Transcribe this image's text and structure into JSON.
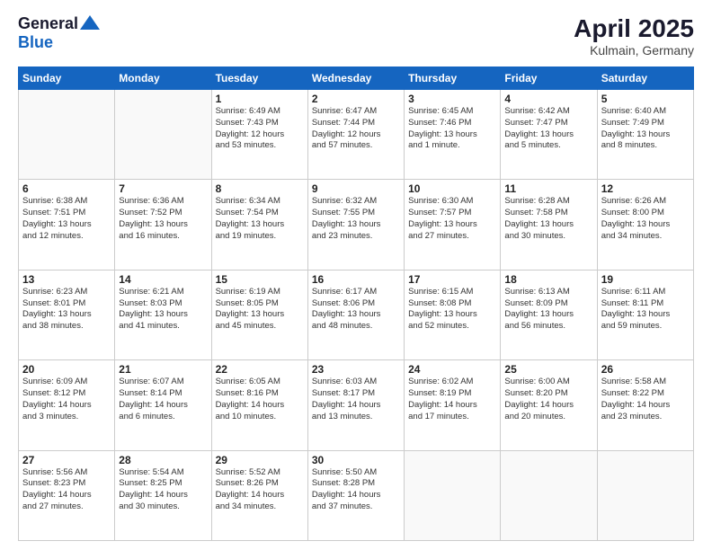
{
  "logo": {
    "general": "General",
    "blue": "Blue"
  },
  "title": {
    "month": "April 2025",
    "location": "Kulmain, Germany"
  },
  "calendar": {
    "headers": [
      "Sunday",
      "Monday",
      "Tuesday",
      "Wednesday",
      "Thursday",
      "Friday",
      "Saturday"
    ],
    "rows": [
      [
        {
          "day": "",
          "detail": ""
        },
        {
          "day": "",
          "detail": ""
        },
        {
          "day": "1",
          "detail": "Sunrise: 6:49 AM\nSunset: 7:43 PM\nDaylight: 12 hours\nand 53 minutes."
        },
        {
          "day": "2",
          "detail": "Sunrise: 6:47 AM\nSunset: 7:44 PM\nDaylight: 12 hours\nand 57 minutes."
        },
        {
          "day": "3",
          "detail": "Sunrise: 6:45 AM\nSunset: 7:46 PM\nDaylight: 13 hours\nand 1 minute."
        },
        {
          "day": "4",
          "detail": "Sunrise: 6:42 AM\nSunset: 7:47 PM\nDaylight: 13 hours\nand 5 minutes."
        },
        {
          "day": "5",
          "detail": "Sunrise: 6:40 AM\nSunset: 7:49 PM\nDaylight: 13 hours\nand 8 minutes."
        }
      ],
      [
        {
          "day": "6",
          "detail": "Sunrise: 6:38 AM\nSunset: 7:51 PM\nDaylight: 13 hours\nand 12 minutes."
        },
        {
          "day": "7",
          "detail": "Sunrise: 6:36 AM\nSunset: 7:52 PM\nDaylight: 13 hours\nand 16 minutes."
        },
        {
          "day": "8",
          "detail": "Sunrise: 6:34 AM\nSunset: 7:54 PM\nDaylight: 13 hours\nand 19 minutes."
        },
        {
          "day": "9",
          "detail": "Sunrise: 6:32 AM\nSunset: 7:55 PM\nDaylight: 13 hours\nand 23 minutes."
        },
        {
          "day": "10",
          "detail": "Sunrise: 6:30 AM\nSunset: 7:57 PM\nDaylight: 13 hours\nand 27 minutes."
        },
        {
          "day": "11",
          "detail": "Sunrise: 6:28 AM\nSunset: 7:58 PM\nDaylight: 13 hours\nand 30 minutes."
        },
        {
          "day": "12",
          "detail": "Sunrise: 6:26 AM\nSunset: 8:00 PM\nDaylight: 13 hours\nand 34 minutes."
        }
      ],
      [
        {
          "day": "13",
          "detail": "Sunrise: 6:23 AM\nSunset: 8:01 PM\nDaylight: 13 hours\nand 38 minutes."
        },
        {
          "day": "14",
          "detail": "Sunrise: 6:21 AM\nSunset: 8:03 PM\nDaylight: 13 hours\nand 41 minutes."
        },
        {
          "day": "15",
          "detail": "Sunrise: 6:19 AM\nSunset: 8:05 PM\nDaylight: 13 hours\nand 45 minutes."
        },
        {
          "day": "16",
          "detail": "Sunrise: 6:17 AM\nSunset: 8:06 PM\nDaylight: 13 hours\nand 48 minutes."
        },
        {
          "day": "17",
          "detail": "Sunrise: 6:15 AM\nSunset: 8:08 PM\nDaylight: 13 hours\nand 52 minutes."
        },
        {
          "day": "18",
          "detail": "Sunrise: 6:13 AM\nSunset: 8:09 PM\nDaylight: 13 hours\nand 56 minutes."
        },
        {
          "day": "19",
          "detail": "Sunrise: 6:11 AM\nSunset: 8:11 PM\nDaylight: 13 hours\nand 59 minutes."
        }
      ],
      [
        {
          "day": "20",
          "detail": "Sunrise: 6:09 AM\nSunset: 8:12 PM\nDaylight: 14 hours\nand 3 minutes."
        },
        {
          "day": "21",
          "detail": "Sunrise: 6:07 AM\nSunset: 8:14 PM\nDaylight: 14 hours\nand 6 minutes."
        },
        {
          "day": "22",
          "detail": "Sunrise: 6:05 AM\nSunset: 8:16 PM\nDaylight: 14 hours\nand 10 minutes."
        },
        {
          "day": "23",
          "detail": "Sunrise: 6:03 AM\nSunset: 8:17 PM\nDaylight: 14 hours\nand 13 minutes."
        },
        {
          "day": "24",
          "detail": "Sunrise: 6:02 AM\nSunset: 8:19 PM\nDaylight: 14 hours\nand 17 minutes."
        },
        {
          "day": "25",
          "detail": "Sunrise: 6:00 AM\nSunset: 8:20 PM\nDaylight: 14 hours\nand 20 minutes."
        },
        {
          "day": "26",
          "detail": "Sunrise: 5:58 AM\nSunset: 8:22 PM\nDaylight: 14 hours\nand 23 minutes."
        }
      ],
      [
        {
          "day": "27",
          "detail": "Sunrise: 5:56 AM\nSunset: 8:23 PM\nDaylight: 14 hours\nand 27 minutes."
        },
        {
          "day": "28",
          "detail": "Sunrise: 5:54 AM\nSunset: 8:25 PM\nDaylight: 14 hours\nand 30 minutes."
        },
        {
          "day": "29",
          "detail": "Sunrise: 5:52 AM\nSunset: 8:26 PM\nDaylight: 14 hours\nand 34 minutes."
        },
        {
          "day": "30",
          "detail": "Sunrise: 5:50 AM\nSunset: 8:28 PM\nDaylight: 14 hours\nand 37 minutes."
        },
        {
          "day": "",
          "detail": ""
        },
        {
          "day": "",
          "detail": ""
        },
        {
          "day": "",
          "detail": ""
        }
      ]
    ]
  }
}
